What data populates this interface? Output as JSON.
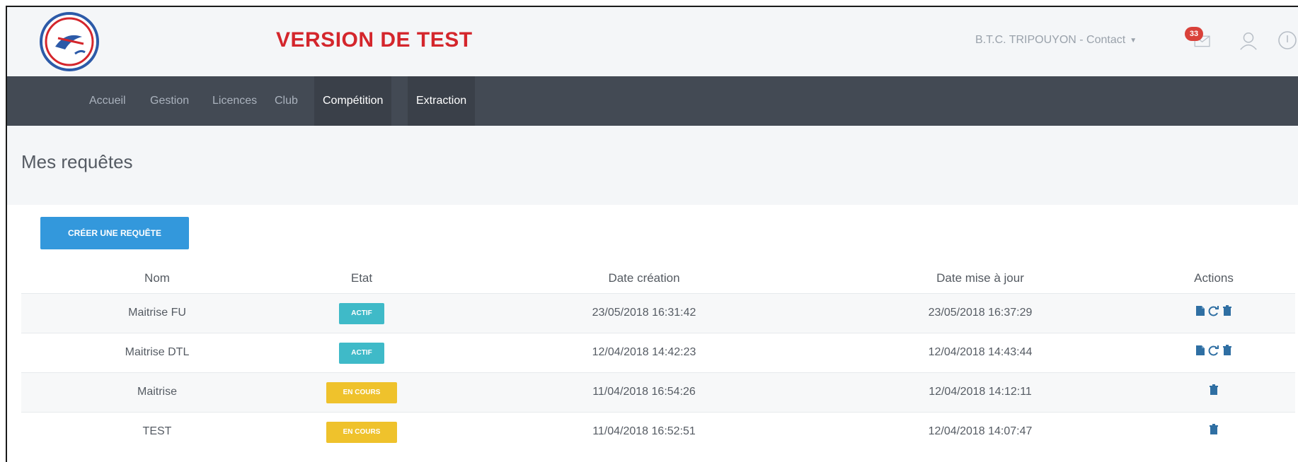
{
  "header": {
    "version_label": "VERSION DE TEST",
    "contact_label": "B.T.C. TRIPOUYON - Contact",
    "badge_count": "33"
  },
  "navbar": {
    "items": [
      {
        "label": "Accueil"
      },
      {
        "label": "Gestion"
      },
      {
        "label": "Licences"
      },
      {
        "label": "Club"
      },
      {
        "label": "Compétition"
      },
      {
        "label": "Extraction"
      }
    ]
  },
  "page": {
    "title": "Mes requêtes",
    "create_button": "CRÉER UNE REQUÊTE"
  },
  "table": {
    "headers": {
      "nom": "Nom",
      "etat": "Etat",
      "date_creation": "Date création",
      "date_maj": "Date mise à jour",
      "actions": "Actions"
    },
    "rows": [
      {
        "nom": "Maitrise FU",
        "etat": "ACTIF",
        "date_creation": "23/05/2018 16:31:42",
        "date_maj": "23/05/2018 16:37:29"
      },
      {
        "nom": "Maitrise DTL",
        "etat": "ACTIF",
        "date_creation": "12/04/2018 14:42:23",
        "date_maj": "12/04/2018 14:43:44"
      },
      {
        "nom": "Maitrise",
        "etat": "EN COURS",
        "date_creation": "11/04/2018 16:54:26",
        "date_maj": "12/04/2018 14:12:11"
      },
      {
        "nom": "TEST",
        "etat": "EN COURS",
        "date_creation": "11/04/2018 16:52:51",
        "date_maj": "12/04/2018 14:07:47"
      }
    ]
  },
  "colors": {
    "brand_red": "#d4262c",
    "navbar_bg": "#434a54",
    "primary_blue": "#3398dc",
    "state_actif": "#3fbac8",
    "state_en_cours": "#efc22c",
    "action_icon": "#2f6fa3"
  },
  "icons": {
    "logo": "fftb-logo-icon",
    "mail": "mail-icon",
    "user": "user-icon",
    "logout": "logout-icon",
    "file": "file-icon",
    "refresh": "refresh-icon",
    "trash": "trash-icon"
  }
}
